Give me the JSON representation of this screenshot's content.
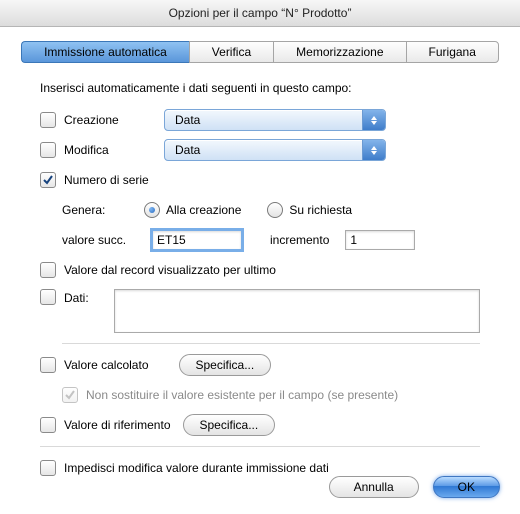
{
  "window": {
    "title": "Opzioni per il campo “N° Prodotto”"
  },
  "tabs": {
    "auto": "Immissione automatica",
    "verify": "Verifica",
    "store": "Memorizzazione",
    "furi": "Furigana"
  },
  "lead": "Inserisci automaticamente i dati seguenti in questo campo:",
  "creation": {
    "label": "Creazione",
    "select": "Data"
  },
  "modification": {
    "label": "Modifica",
    "select": "Data"
  },
  "serial": {
    "label": "Numero di serie",
    "genera_label": "Genera:",
    "opt_create": "Alla creazione",
    "opt_request": "Su richiesta",
    "next_label": "valore succ.",
    "next_value": "ET15",
    "incr_label": "incremento",
    "incr_value": "1"
  },
  "lastrecord": {
    "label": "Valore dal record visualizzato per ultimo"
  },
  "data": {
    "label": "Dati:"
  },
  "calc": {
    "label": "Valore calcolato",
    "btn": "Specifica...",
    "no_replace": "Non sostituire il valore esistente per il campo (se presente)"
  },
  "lookup": {
    "label": "Valore di riferimento",
    "btn": "Specifica..."
  },
  "prohibit": {
    "label": "Impedisci modifica valore durante immissione dati"
  },
  "buttons": {
    "cancel": "Annulla",
    "ok": "OK"
  }
}
